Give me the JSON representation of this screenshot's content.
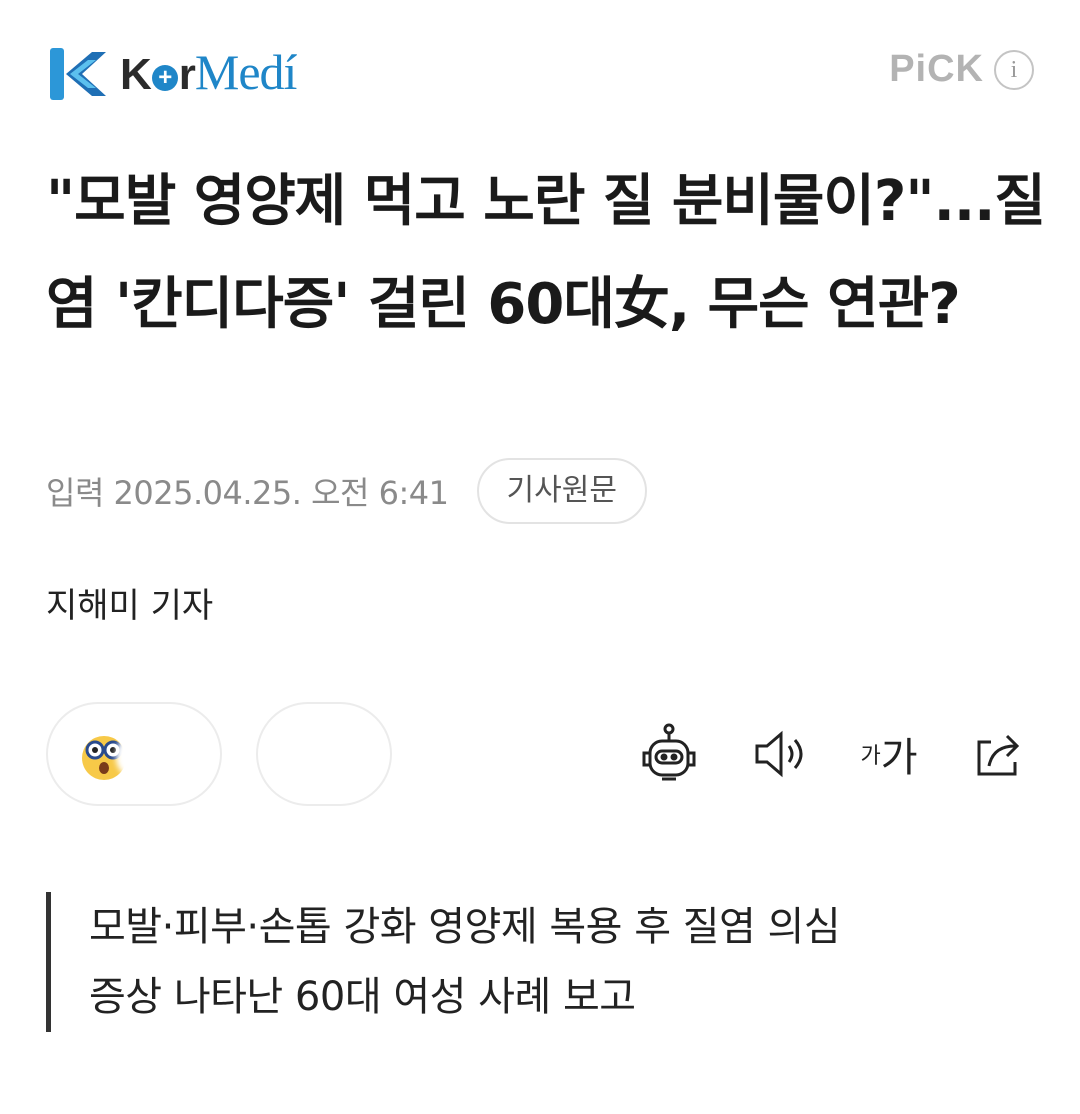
{
  "header": {
    "brand": {
      "k": "K",
      "r": "r",
      "medi": "Medí"
    },
    "pick_label": "PiCK",
    "info_icon_glyph": "i"
  },
  "article": {
    "headline": "\"모발 영양제 먹고 노란 질 분비물이?\"...질염 '칸디다증' 걸린 60대女, 무슨 연관?",
    "date": "입력 2025.04.25. 오전 6:41",
    "original_button": "기사원문",
    "reporter": "지해미 기자",
    "summary_lines": [
      "모발·피부·손톱 강화 영양제 복용 후 질염 의심",
      "증상 나타난 60대 여성 사례 보고"
    ]
  },
  "toolbar": {
    "font_small": "가",
    "font_big": "가",
    "icons": [
      "robot-summary-icon",
      "speaker-icon",
      "font-size-icon",
      "share-icon"
    ]
  },
  "colors": {
    "brand_blue": "#1f86c8",
    "pick_gray": "#b3b3b3",
    "text": "#1a1a1a",
    "muted": "#8a8a8a"
  }
}
